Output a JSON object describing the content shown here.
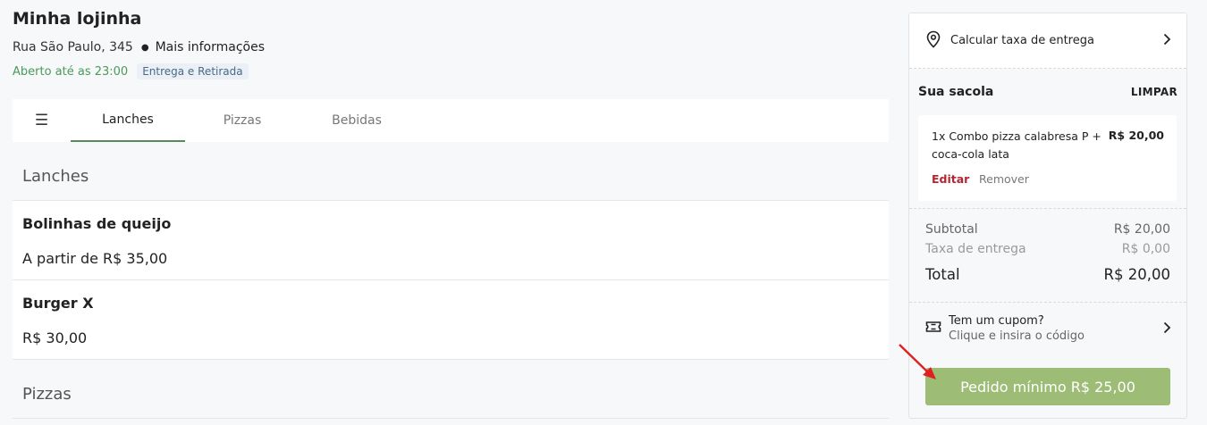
{
  "store": {
    "name": "Minha lojinha",
    "address": "Rua São Paulo, 345",
    "more_info": "Mais informações",
    "status": "Aberto até as 23:00",
    "badge": "Entrega e Retirada"
  },
  "tabs": {
    "menu_icon": "hamburger-icon",
    "items": [
      {
        "label": "Lanches",
        "active": true
      },
      {
        "label": "Pizzas",
        "active": false
      },
      {
        "label": "Bebidas",
        "active": false
      }
    ]
  },
  "sections": [
    {
      "title": "Lanches",
      "products": [
        {
          "name": "Bolinhas de queijo",
          "price": "A partir de R$ 35,00"
        },
        {
          "name": "Burger X",
          "price": "R$ 30,00"
        }
      ]
    },
    {
      "title": "Pizzas",
      "products": []
    }
  ],
  "cart": {
    "delivery_fee_label": "Calcular taxa de entrega",
    "bag_title": "Sua sacola",
    "clear_label": "LIMPAR",
    "items": [
      {
        "name": "1x Combo pizza calabresa P + coca-cola lata",
        "price": "R$ 20,00",
        "edit_label": "Editar",
        "remove_label": "Remover"
      }
    ],
    "subtotal_label": "Subtotal",
    "subtotal_value": "R$ 20,00",
    "fee_label": "Taxa de entrega",
    "fee_value": "R$ 0,00",
    "total_label": "Total",
    "total_value": "R$ 20,00",
    "coupon_title": "Tem um cupom?",
    "coupon_subtitle": "Clique e insira o código",
    "checkout_label": "Pedido mínimo R$ 25,00"
  },
  "colors": {
    "accent_green": "#4a9a5a",
    "checkout_button": "#9dbd76",
    "edit_red": "#b3262f",
    "annotation_arrow": "#e02020"
  }
}
